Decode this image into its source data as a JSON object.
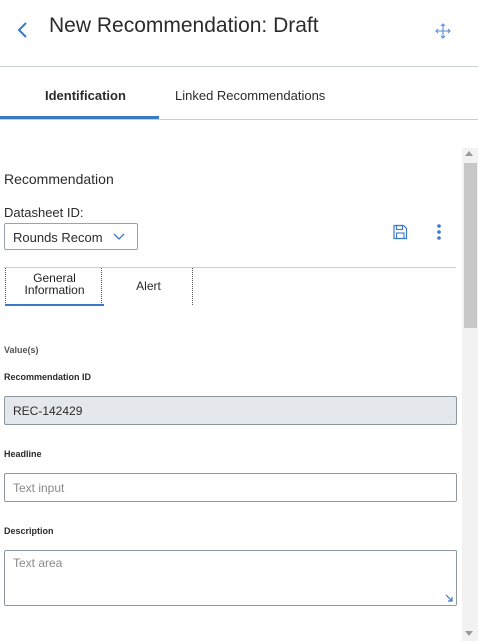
{
  "header": {
    "title": "New Recommendation: Draft",
    "back_icon": "chevron-left-icon",
    "move_icon": "move-arrows-icon",
    "accent_color": "#3b78c8"
  },
  "tabs": [
    {
      "label": "Identification",
      "active": true
    },
    {
      "label": "Linked Recommendations",
      "active": false
    }
  ],
  "section": {
    "title": "Recommendation",
    "datasheet_label": "Datasheet ID:",
    "datasheet_value": "Rounds Recom",
    "save_icon": "save-icon",
    "more_icon": "more-vertical-icon"
  },
  "subtabs": [
    {
      "label": "General Information",
      "active": true
    },
    {
      "label": "Alert",
      "active": false
    }
  ],
  "form": {
    "group_label": "Value(s)",
    "recommendation_id_label": "Recommendation ID",
    "recommendation_id_value": "REC-142429",
    "headline_label": "Headline",
    "headline_placeholder": "Text input",
    "description_label": "Description",
    "description_placeholder": "Text area"
  }
}
